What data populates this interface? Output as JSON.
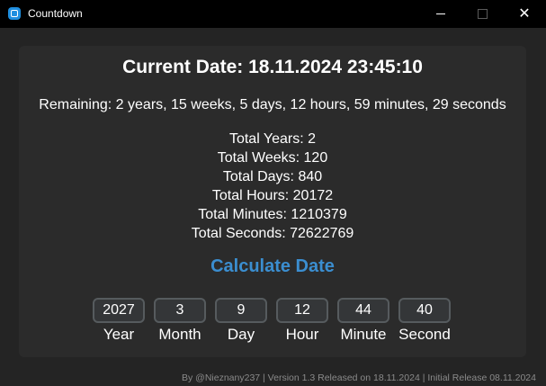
{
  "window": {
    "title": "Countdown",
    "minimize_icon": "minimize-icon",
    "maximize_icon": "maximize-icon",
    "close_glyph": "✕"
  },
  "colors": {
    "background": "#242424",
    "panel": "#2b2b2b",
    "accent": "#3b8ed0",
    "input_bg": "#343638",
    "input_border": "#565b5e"
  },
  "current_date": "Current Date: 18.11.2024 23:45:10",
  "remaining": "Remaining: 2 years, 15 weeks, 5 days, 12 hours, 59 minutes, 29 seconds",
  "totals": [
    "Total Years: 2",
    "Total Weeks: 120",
    "Total Days: 840",
    "Total Hours: 20172",
    "Total Minutes: 1210379",
    "Total Seconds: 72622769"
  ],
  "calculate_button": "Calculate Date",
  "fields": [
    {
      "value": "2027",
      "label": "Year"
    },
    {
      "value": "3",
      "label": "Month"
    },
    {
      "value": "9",
      "label": "Day"
    },
    {
      "value": "12",
      "label": "Hour"
    },
    {
      "value": "44",
      "label": "Minute"
    },
    {
      "value": "40",
      "label": "Second"
    }
  ],
  "footer": "By @Nieznany237 | Version 1.3 Released on 18.11.2024 | Initial Release 08.11.2024"
}
